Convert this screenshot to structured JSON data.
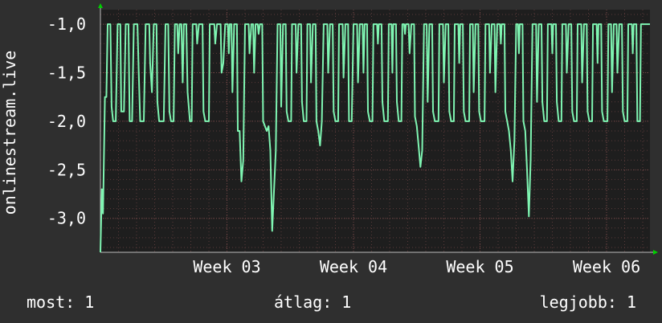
{
  "colors": {
    "background": "#2f2f2f",
    "plot_background": "#1e1e1e",
    "line": "#7ff5b2",
    "grid": "#5a3a3a",
    "axis_arrow": "#00d000",
    "text": "#ffffff"
  },
  "stats": {
    "now": "most: 1",
    "avg": "átlag: 1",
    "best": "legjobb: 1"
  },
  "chart_data": {
    "type": "line",
    "ylabel": "onlinestream.live",
    "ylim": [
      -3.35,
      -0.85
    ],
    "y_ticks": [
      {
        "value": -1.0,
        "label": "-1,0"
      },
      {
        "value": -1.5,
        "label": "-1,5"
      },
      {
        "value": -2.0,
        "label": "-2,0"
      },
      {
        "value": -2.5,
        "label": "-2,5"
      },
      {
        "value": -3.0,
        "label": "-3,0"
      }
    ],
    "x_ticks": [
      {
        "value": 7,
        "label": "Week 03"
      },
      {
        "value": 14,
        "label": "Week 04"
      },
      {
        "value": 21,
        "label": "Week 05"
      },
      {
        "value": 28,
        "label": "Week 06"
      }
    ],
    "xlim": [
      0,
      30.4
    ],
    "grid": true,
    "series": [
      {
        "values": [
          [
            0.0,
            -3.35
          ],
          [
            0.08,
            -2.7
          ],
          [
            0.14,
            -2.95
          ],
          [
            0.25,
            -1.75
          ],
          [
            0.33,
            -1.75
          ],
          [
            0.4,
            -1.0
          ],
          [
            0.55,
            -1.0
          ],
          [
            0.62,
            -1.85
          ],
          [
            0.7,
            -2.0
          ],
          [
            0.85,
            -2.0
          ],
          [
            0.95,
            -1.0
          ],
          [
            1.1,
            -1.0
          ],
          [
            1.15,
            -1.9
          ],
          [
            1.3,
            -1.9
          ],
          [
            1.4,
            -1.0
          ],
          [
            1.55,
            -1.0
          ],
          [
            1.62,
            -2.0
          ],
          [
            1.75,
            -2.0
          ],
          [
            1.85,
            -1.0
          ],
          [
            2.05,
            -1.0
          ],
          [
            2.12,
            -1.5
          ],
          [
            2.2,
            -2.0
          ],
          [
            2.4,
            -2.0
          ],
          [
            2.5,
            -1.0
          ],
          [
            2.7,
            -1.0
          ],
          [
            2.75,
            -1.4
          ],
          [
            2.85,
            -1.7
          ],
          [
            2.95,
            -1.0
          ],
          [
            3.1,
            -1.0
          ],
          [
            3.15,
            -1.8
          ],
          [
            3.25,
            -2.0
          ],
          [
            3.5,
            -2.0
          ],
          [
            3.6,
            -1.0
          ],
          [
            3.75,
            -1.0
          ],
          [
            3.82,
            -1.9
          ],
          [
            3.9,
            -2.0
          ],
          [
            4.05,
            -2.0
          ],
          [
            4.12,
            -1.0
          ],
          [
            4.25,
            -1.0
          ],
          [
            4.3,
            -1.3
          ],
          [
            4.38,
            -1.0
          ],
          [
            4.48,
            -1.0
          ],
          [
            4.55,
            -1.6
          ],
          [
            4.62,
            -1.0
          ],
          [
            4.75,
            -1.0
          ],
          [
            4.82,
            -1.7
          ],
          [
            4.95,
            -2.0
          ],
          [
            5.05,
            -2.0
          ],
          [
            5.1,
            -1.0
          ],
          [
            5.3,
            -1.0
          ],
          [
            5.35,
            -1.2
          ],
          [
            5.45,
            -1.0
          ],
          [
            5.65,
            -1.0
          ],
          [
            5.7,
            -1.9
          ],
          [
            5.8,
            -2.0
          ],
          [
            6.0,
            -2.0
          ],
          [
            6.05,
            -1.0
          ],
          [
            6.3,
            -1.0
          ],
          [
            6.35,
            -1.2
          ],
          [
            6.45,
            -1.0
          ],
          [
            6.65,
            -1.0
          ],
          [
            6.7,
            -1.5
          ],
          [
            6.8,
            -1.4
          ],
          [
            6.9,
            -1.0
          ],
          [
            7.05,
            -1.0
          ],
          [
            7.1,
            -1.3
          ],
          [
            7.15,
            -1.0
          ],
          [
            7.25,
            -1.0
          ],
          [
            7.3,
            -1.7
          ],
          [
            7.4,
            -1.0
          ],
          [
            7.55,
            -1.0
          ],
          [
            7.6,
            -2.1
          ],
          [
            7.7,
            -2.1
          ],
          [
            7.8,
            -2.62
          ],
          [
            7.9,
            -2.4
          ],
          [
            8.0,
            -1.0
          ],
          [
            8.2,
            -1.0
          ],
          [
            8.25,
            -1.3
          ],
          [
            8.35,
            -1.0
          ],
          [
            8.45,
            -1.0
          ],
          [
            8.5,
            -1.5
          ],
          [
            8.58,
            -1.0
          ],
          [
            8.7,
            -1.0
          ],
          [
            8.75,
            -1.1
          ],
          [
            8.82,
            -1.0
          ],
          [
            8.95,
            -1.0
          ],
          [
            9.0,
            -2.0
          ],
          [
            9.2,
            -2.1
          ],
          [
            9.3,
            -2.05
          ],
          [
            9.4,
            -2.3
          ],
          [
            9.5,
            -3.13
          ],
          [
            9.7,
            -2.3
          ],
          [
            9.8,
            -1.0
          ],
          [
            9.95,
            -1.0
          ],
          [
            10.0,
            -1.85
          ],
          [
            10.1,
            -1.0
          ],
          [
            10.25,
            -1.0
          ],
          [
            10.3,
            -1.9
          ],
          [
            10.4,
            -2.0
          ],
          [
            10.55,
            -2.0
          ],
          [
            10.6,
            -1.0
          ],
          [
            10.8,
            -1.0
          ],
          [
            10.85,
            -1.5
          ],
          [
            10.95,
            -1.0
          ],
          [
            11.1,
            -1.0
          ],
          [
            11.15,
            -1.8
          ],
          [
            11.25,
            -2.0
          ],
          [
            11.4,
            -2.0
          ],
          [
            11.45,
            -1.0
          ],
          [
            11.6,
            -1.0
          ],
          [
            11.65,
            -1.6
          ],
          [
            11.75,
            -1.0
          ],
          [
            11.9,
            -1.0
          ],
          [
            11.95,
            -2.0
          ],
          [
            12.05,
            -2.1
          ],
          [
            12.15,
            -2.25
          ],
          [
            12.25,
            -2.0
          ],
          [
            12.35,
            -1.0
          ],
          [
            12.55,
            -1.0
          ],
          [
            12.6,
            -1.5
          ],
          [
            12.7,
            -1.0
          ],
          [
            12.85,
            -1.0
          ],
          [
            12.9,
            -1.9
          ],
          [
            13.0,
            -2.0
          ],
          [
            13.15,
            -2.0
          ],
          [
            13.2,
            -1.0
          ],
          [
            13.4,
            -1.0
          ],
          [
            13.45,
            -1.55
          ],
          [
            13.55,
            -1.0
          ],
          [
            13.7,
            -1.0
          ],
          [
            13.75,
            -2.0
          ],
          [
            13.9,
            -2.0
          ],
          [
            14.0,
            -1.0
          ],
          [
            14.2,
            -1.0
          ],
          [
            14.25,
            -1.6
          ],
          [
            14.35,
            -1.0
          ],
          [
            14.5,
            -1.0
          ],
          [
            14.55,
            -1.5
          ],
          [
            14.62,
            -1.0
          ],
          [
            14.75,
            -1.0
          ],
          [
            14.8,
            -1.9
          ],
          [
            14.9,
            -2.0
          ],
          [
            15.05,
            -2.0
          ],
          [
            15.1,
            -1.0
          ],
          [
            15.3,
            -1.0
          ],
          [
            15.35,
            -1.2
          ],
          [
            15.4,
            -1.0
          ],
          [
            15.55,
            -1.0
          ],
          [
            15.6,
            -1.8
          ],
          [
            15.7,
            -2.0
          ],
          [
            15.9,
            -2.0
          ],
          [
            15.95,
            -1.0
          ],
          [
            16.1,
            -1.0
          ],
          [
            16.15,
            -1.5
          ],
          [
            16.2,
            -1.0
          ],
          [
            16.35,
            -1.0
          ],
          [
            16.4,
            -1.8
          ],
          [
            16.5,
            -2.0
          ],
          [
            16.65,
            -2.0
          ],
          [
            16.7,
            -1.0
          ],
          [
            16.8,
            -1.0
          ],
          [
            16.85,
            -1.1
          ],
          [
            16.9,
            -1.0
          ],
          [
            17.05,
            -1.0
          ],
          [
            17.1,
            -1.3
          ],
          [
            17.2,
            -1.0
          ],
          [
            17.35,
            -1.0
          ],
          [
            17.4,
            -1.95
          ],
          [
            17.5,
            -2.05
          ],
          [
            17.6,
            -2.25
          ],
          [
            17.7,
            -2.47
          ],
          [
            17.8,
            -2.3
          ],
          [
            17.9,
            -1.0
          ],
          [
            18.05,
            -1.0
          ],
          [
            18.1,
            -1.8
          ],
          [
            18.2,
            -1.0
          ],
          [
            18.35,
            -1.0
          ],
          [
            18.4,
            -1.9
          ],
          [
            18.5,
            -2.0
          ],
          [
            18.7,
            -2.0
          ],
          [
            18.75,
            -1.0
          ],
          [
            18.95,
            -1.0
          ],
          [
            19.0,
            -1.6
          ],
          [
            19.1,
            -1.0
          ],
          [
            19.25,
            -1.0
          ],
          [
            19.3,
            -1.9
          ],
          [
            19.4,
            -2.0
          ],
          [
            19.55,
            -2.0
          ],
          [
            19.6,
            -1.0
          ],
          [
            19.8,
            -1.0
          ],
          [
            19.85,
            -1.4
          ],
          [
            19.9,
            -1.0
          ],
          [
            20.05,
            -1.0
          ],
          [
            20.1,
            -1.9
          ],
          [
            20.2,
            -2.0
          ],
          [
            20.4,
            -2.0
          ],
          [
            20.45,
            -1.0
          ],
          [
            20.6,
            -1.0
          ],
          [
            20.65,
            -1.7
          ],
          [
            20.75,
            -1.0
          ],
          [
            20.9,
            -1.0
          ],
          [
            20.95,
            -1.9
          ],
          [
            21.05,
            -2.0
          ],
          [
            21.25,
            -2.0
          ],
          [
            21.3,
            -1.0
          ],
          [
            21.5,
            -1.0
          ],
          [
            21.55,
            -1.5
          ],
          [
            21.65,
            -1.0
          ],
          [
            21.8,
            -1.0
          ],
          [
            21.85,
            -1.7
          ],
          [
            21.95,
            -1.0
          ],
          [
            22.1,
            -1.0
          ],
          [
            22.15,
            -1.2
          ],
          [
            22.2,
            -1.0
          ],
          [
            22.35,
            -1.0
          ],
          [
            22.4,
            -1.9
          ],
          [
            22.5,
            -2.0
          ],
          [
            22.6,
            -2.1
          ],
          [
            22.7,
            -2.3
          ],
          [
            22.8,
            -2.62
          ],
          [
            22.9,
            -2.2
          ],
          [
            23.0,
            -1.0
          ],
          [
            23.1,
            -1.0
          ],
          [
            23.15,
            -1.3
          ],
          [
            23.2,
            -1.0
          ],
          [
            23.35,
            -1.0
          ],
          [
            23.4,
            -2.0
          ],
          [
            23.5,
            -2.1
          ],
          [
            23.6,
            -2.5
          ],
          [
            23.7,
            -2.98
          ],
          [
            23.8,
            -2.4
          ],
          [
            23.9,
            -1.0
          ],
          [
            24.1,
            -1.0
          ],
          [
            24.15,
            -1.8
          ],
          [
            24.25,
            -1.0
          ],
          [
            24.4,
            -1.0
          ],
          [
            24.45,
            -1.8
          ],
          [
            24.55,
            -2.0
          ],
          [
            24.7,
            -2.0
          ],
          [
            24.75,
            -1.0
          ],
          [
            24.95,
            -1.0
          ],
          [
            25.0,
            -1.3
          ],
          [
            25.05,
            -1.0
          ],
          [
            25.2,
            -1.0
          ],
          [
            25.25,
            -1.8
          ],
          [
            25.35,
            -2.0
          ],
          [
            25.5,
            -2.0
          ],
          [
            25.55,
            -1.0
          ],
          [
            25.75,
            -1.0
          ],
          [
            25.8,
            -1.5
          ],
          [
            25.9,
            -1.0
          ],
          [
            26.05,
            -1.0
          ],
          [
            26.1,
            -1.9
          ],
          [
            26.2,
            -2.0
          ],
          [
            26.35,
            -2.0
          ],
          [
            26.4,
            -1.0
          ],
          [
            26.6,
            -1.0
          ],
          [
            26.65,
            -1.6
          ],
          [
            26.75,
            -1.0
          ],
          [
            26.9,
            -1.0
          ],
          [
            26.95,
            -1.9
          ],
          [
            27.05,
            -2.0
          ],
          [
            27.2,
            -2.0
          ],
          [
            27.25,
            -1.0
          ],
          [
            27.45,
            -1.0
          ],
          [
            27.5,
            -1.4
          ],
          [
            27.55,
            -1.0
          ],
          [
            27.7,
            -1.0
          ],
          [
            27.75,
            -1.9
          ],
          [
            27.85,
            -2.0
          ],
          [
            28.05,
            -2.0
          ],
          [
            28.1,
            -1.0
          ],
          [
            28.25,
            -1.0
          ],
          [
            28.3,
            -1.7
          ],
          [
            28.4,
            -1.0
          ],
          [
            28.55,
            -1.0
          ],
          [
            28.6,
            -1.5
          ],
          [
            28.7,
            -1.0
          ],
          [
            28.85,
            -1.0
          ],
          [
            28.9,
            -1.9
          ],
          [
            29.0,
            -2.0
          ],
          [
            29.15,
            -2.0
          ],
          [
            29.2,
            -1.0
          ],
          [
            29.4,
            -1.0
          ],
          [
            29.45,
            -1.3
          ],
          [
            29.5,
            -1.0
          ],
          [
            29.65,
            -1.0
          ],
          [
            29.7,
            -2.0
          ],
          [
            29.85,
            -2.0
          ],
          [
            29.9,
            -1.0
          ],
          [
            30.4,
            -1.0
          ]
        ]
      }
    ]
  }
}
